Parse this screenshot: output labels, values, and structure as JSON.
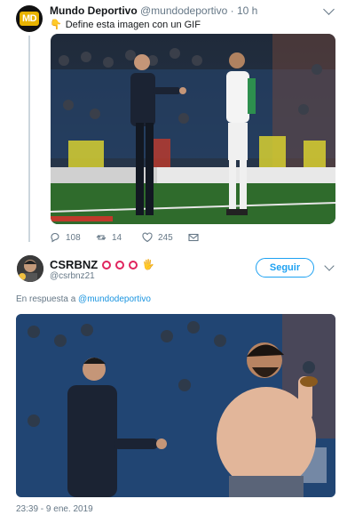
{
  "tweet": {
    "author_name": "Mundo Deportivo",
    "author_handle": "@mundodeportivo",
    "separator": "·",
    "time": "10 h",
    "avatar_logo": "MD",
    "text_icon": "pointing-hand-icon",
    "text": "Define esta imagen con un GIF",
    "actions": {
      "replies": "108",
      "retweets": "14",
      "likes": "245"
    }
  },
  "reply_tweet": {
    "author_name": "CSRBNZ",
    "author_handle": "@csrbnz21",
    "name_icons": [
      "red-circle-icon",
      "red-circle-icon",
      "red-circle-icon",
      "raised-hand-icon"
    ],
    "follow_label": "Seguir",
    "reply_prefix": "En respuesta a",
    "reply_to": "@mundodeportivo",
    "timestamp": "23:39 - 9 ene. 2019"
  },
  "colors": {
    "accent": "#1da1f2",
    "muted": "#657786",
    "red_ring": "#e0245e",
    "pitch": "#2f6b2c"
  }
}
